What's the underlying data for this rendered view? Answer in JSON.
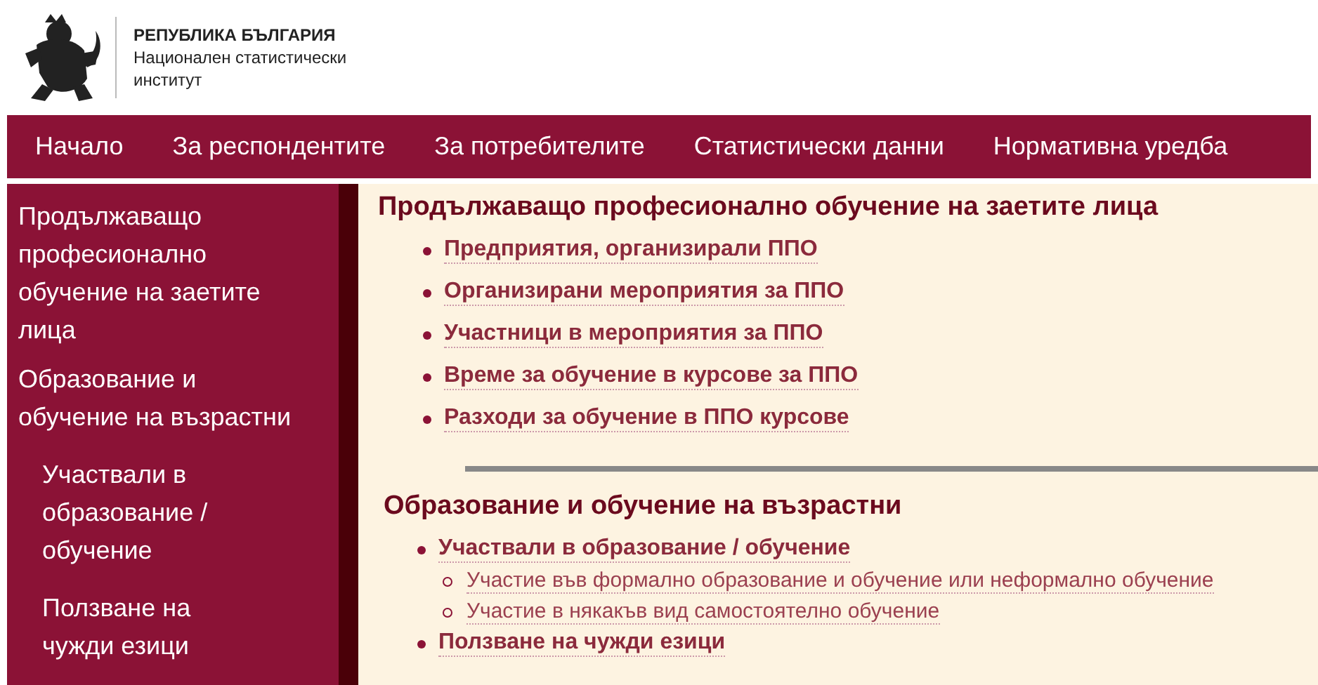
{
  "header": {
    "title": "РЕПУБЛИКА БЪЛГАРИЯ",
    "subtitle": "Национален статистически институт"
  },
  "nav": [
    "Начало",
    "За респондентите",
    "За потребителите",
    "Статистически данни",
    "Нормативна уредба"
  ],
  "sidebar": {
    "items": [
      {
        "label": "Продължаващо професионално обучение на заетите лица"
      },
      {
        "label": "Образование и обучение на възрастни",
        "children": [
          {
            "label": "Участвали в образование / обучение"
          },
          {
            "label": "Ползване на чужди езици"
          }
        ]
      }
    ]
  },
  "sections": [
    {
      "title": "Продължаващо професионално обучение на заетите лица",
      "links": [
        {
          "label": "Предприятия, организирали ППО"
        },
        {
          "label": "Организирани мероприятия за ППО"
        },
        {
          "label": "Участници в мероприятия за ППО"
        },
        {
          "label": "Време за обучение в курсове за ППО"
        },
        {
          "label": "Разходи за обучение в ППО курсове"
        }
      ]
    },
    {
      "title": "Образование и обучение на възрастни",
      "links": [
        {
          "label": "Участвали в образование / обучение",
          "children": [
            {
              "label": "Участие във формално образование и обучение или неформално обучение"
            },
            {
              "label": "Участие в някакъв вид самостоятелно обучение"
            }
          ]
        },
        {
          "label": "Ползване на чужди езици"
        }
      ]
    }
  ]
}
